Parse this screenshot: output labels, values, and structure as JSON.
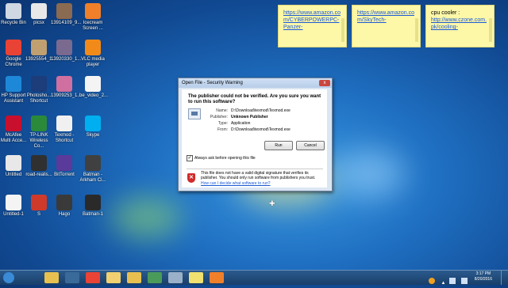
{
  "desktop_icons": [
    {
      "label": "Recycle Bin",
      "icon": "recycle-bin-icon",
      "color": "#cfd8e3"
    },
    {
      "label": "picsx",
      "icon": "image-file-icon",
      "color": "#e8e8e8"
    },
    {
      "label": "13914109_9...",
      "icon": "photo-icon",
      "color": "#8a6a50"
    },
    {
      "label": "Icecream Screen ...",
      "icon": "icecream-recorder-icon",
      "color": "#f07f2a"
    },
    {
      "label": "Google Chrome",
      "icon": "chrome-icon",
      "color": "#e94335"
    },
    {
      "label": "13925554_1...",
      "icon": "photo-icon",
      "color": "#c0a070"
    },
    {
      "label": "13920330_1...",
      "icon": "photo-icon",
      "color": "#7a6a90"
    },
    {
      "label": "VLC media player",
      "icon": "vlc-icon",
      "color": "#f28a1a"
    },
    {
      "label": "HP Support Assistant",
      "icon": "help-icon",
      "color": "#1e88d8"
    },
    {
      "label": "Photosho... Shortcut",
      "icon": "photoshop-icon",
      "color": "#1c3c7a"
    },
    {
      "label": "13909253_1...",
      "icon": "photo-icon",
      "color": "#d070a0"
    },
    {
      "label": "be_video_2...",
      "icon": "blank-file-icon",
      "color": "#f4f4f4"
    },
    {
      "label": "McAfee Multi Acce...",
      "icon": "mcafee-icon",
      "color": "#c8102e"
    },
    {
      "label": "TP-LINK Wireless Co...",
      "icon": "tplink-icon",
      "color": "#2a8a3a"
    },
    {
      "label": "Texmod - Shortcut",
      "icon": "texmod-icon",
      "color": "#f0f0f0"
    },
    {
      "label": "Skype",
      "icon": "skype-icon",
      "color": "#00aff0"
    },
    {
      "label": "Untitled",
      "icon": "mp3-file-icon",
      "color": "#e8e8e8"
    },
    {
      "label": "road-realis...",
      "icon": "photo-icon",
      "color": "#303030"
    },
    {
      "label": "BitTorrent",
      "icon": "bittorrent-icon",
      "color": "#5a3a9a"
    },
    {
      "label": "Batman - Arkham Ci...",
      "icon": "batman-icon",
      "color": "#404040"
    },
    {
      "label": "Untitled-1",
      "icon": "blank-file-icon",
      "color": "#f4f4f4"
    },
    {
      "label": "S",
      "icon": "app-icon",
      "color": "#d03a2a"
    },
    {
      "label": "Hago",
      "icon": "hago-icon",
      "color": "#3a3a3a"
    },
    {
      "label": "Batman-1",
      "icon": "photo-icon",
      "color": "#2a2a2a"
    }
  ],
  "sticky_notes": [
    {
      "text": "https://www.amazon.com/CYBERPOWERPC-Panzer-",
      "link": true
    },
    {
      "text": "https://www.amazon.com/SkyTech-",
      "link": true
    },
    {
      "title": "cpu cooler :",
      "text": "http://www.czone.com.pk/cooling-",
      "link": true
    }
  ],
  "dialog": {
    "title": "Open File - Security Warning",
    "close_label": "x",
    "question": "The publisher could not be verified.  Are you sure you want to run this software?",
    "fields": [
      {
        "label": "Name:",
        "value": "D:\\Download\\texmod\\Texmod.exe",
        "bold": false
      },
      {
        "label": "Publisher:",
        "value": "Unknown Publisher",
        "bold": true
      },
      {
        "label": "Type:",
        "value": "Application",
        "bold": false
      },
      {
        "label": "From:",
        "value": "D:\\Download\\texmod\\Texmod.exe",
        "bold": false
      }
    ],
    "run_label": "Run",
    "cancel_label": "Cancel",
    "checkbox_label": "Always ask before opening this file",
    "checkbox_checked": true,
    "warning_text": "This file does not have a valid digital signature that verifies its publisher. You should only run software from publishers you trust.",
    "help_link": "How can I decide what software to run?"
  },
  "taskbar": {
    "items": [
      "start-orb-icon",
      "explorer-folder-icon",
      "media-player-icon",
      "chrome-icon",
      "notes-icon",
      "folder-icon",
      "screen-recorder-icon",
      "tablet-icon",
      "sticky-notes-icon",
      "icecream-icon"
    ],
    "time": "3:17 PM",
    "date": "8/20/2016"
  }
}
